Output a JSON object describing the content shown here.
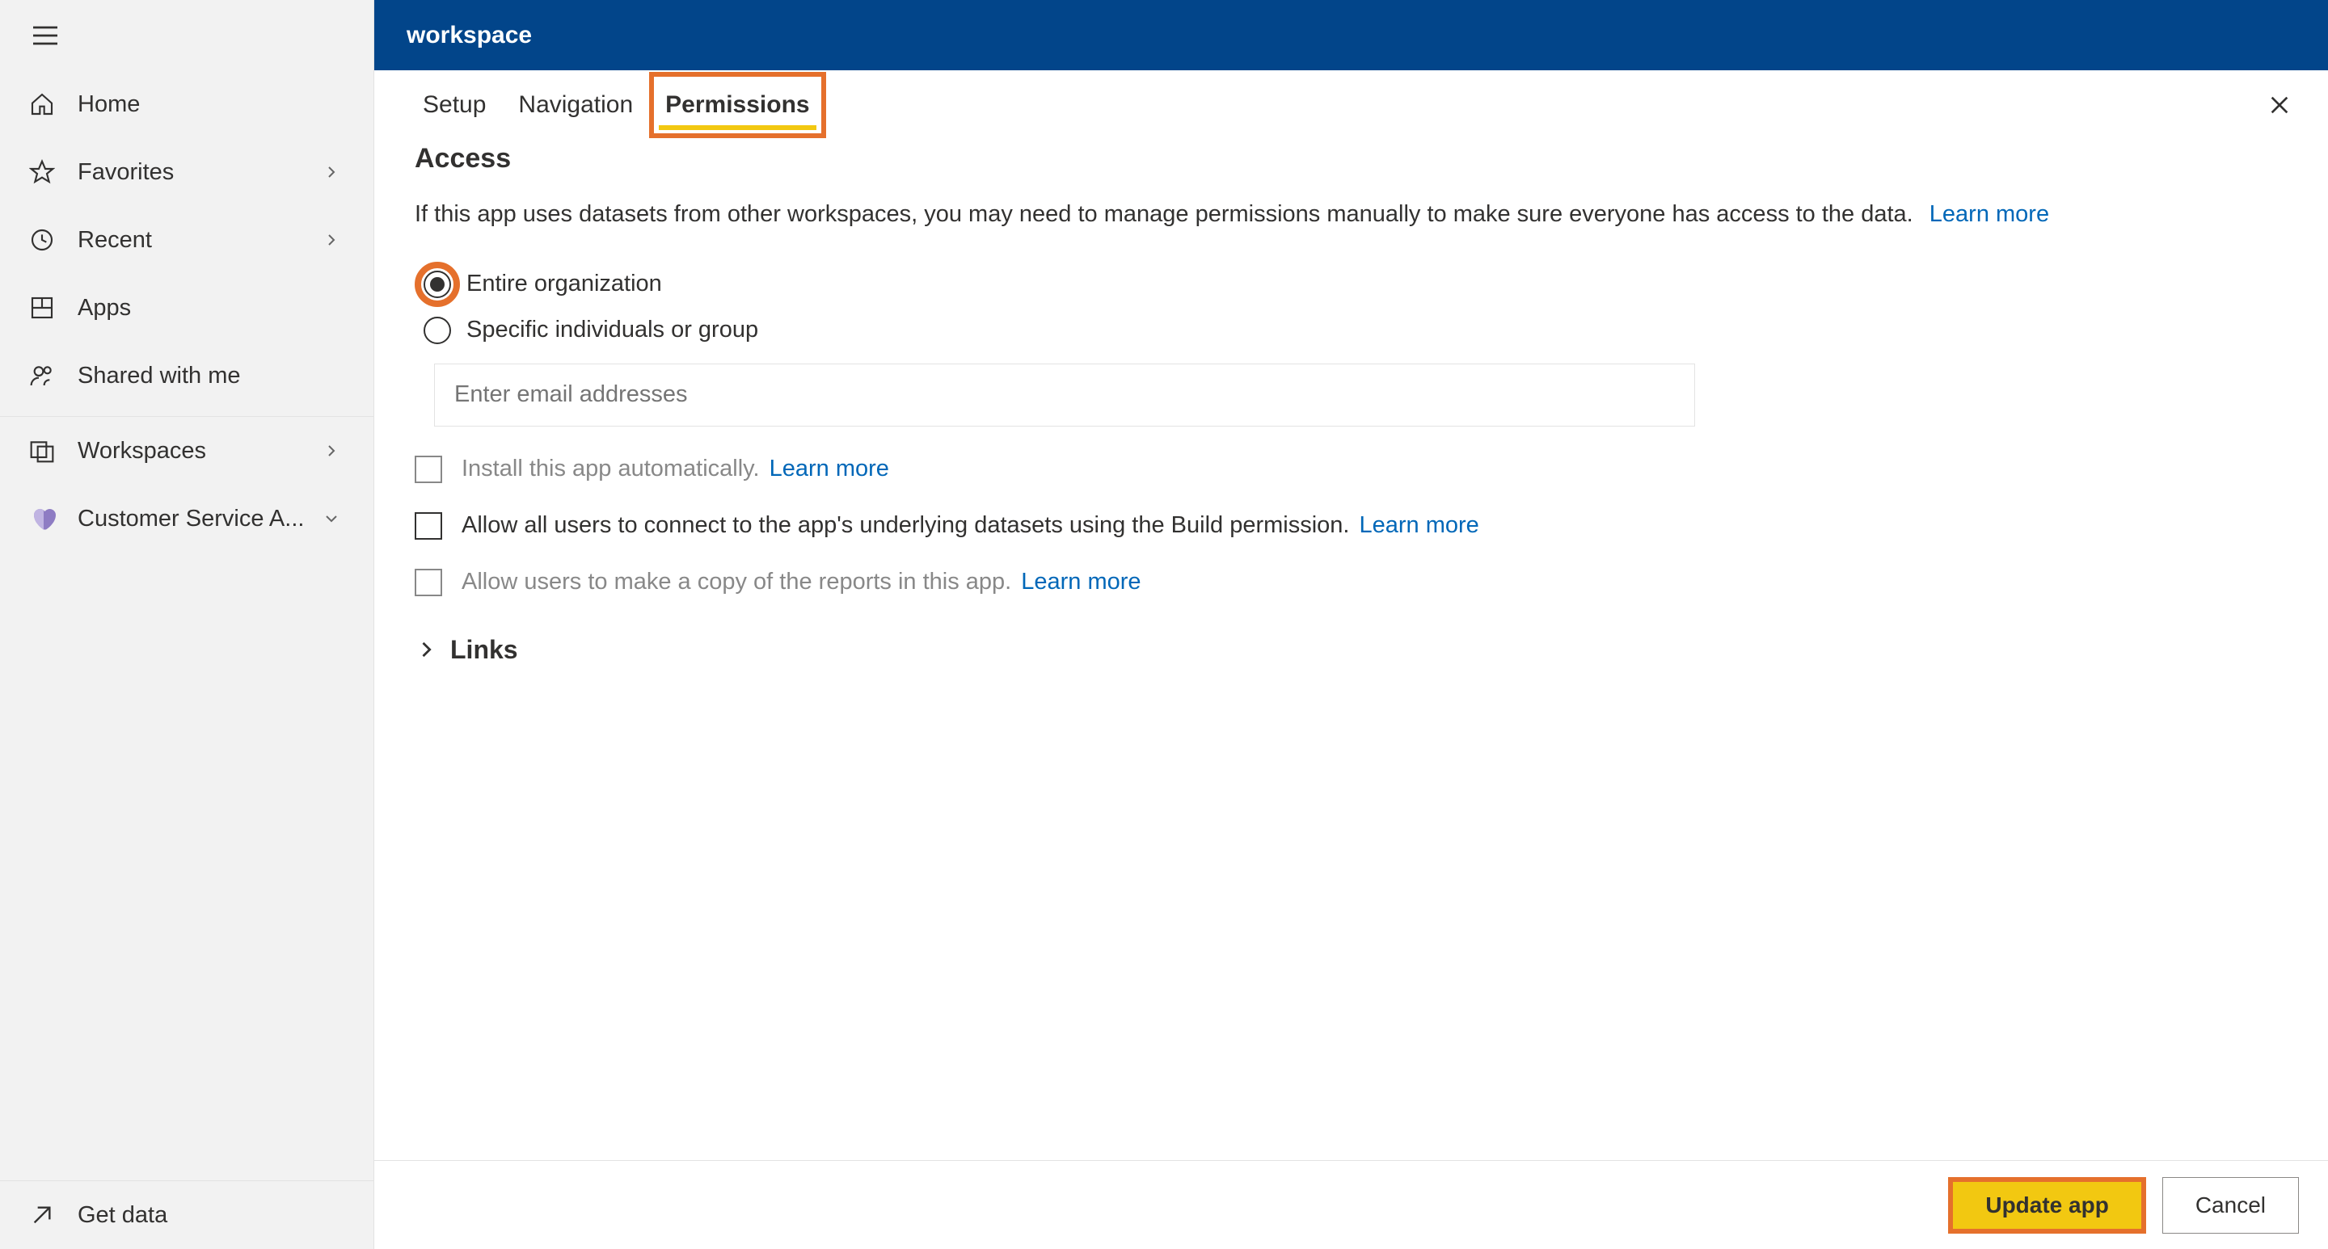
{
  "sidebar": {
    "items": [
      {
        "label": "Home"
      },
      {
        "label": "Favorites"
      },
      {
        "label": "Recent"
      },
      {
        "label": "Apps"
      },
      {
        "label": "Shared with me"
      }
    ],
    "workspaces_label": "Workspaces",
    "current_workspace": "Customer Service A...",
    "get_data_label": "Get data"
  },
  "header": {
    "title": "workspace"
  },
  "tabs": {
    "setup": "Setup",
    "navigation": "Navigation",
    "permissions": "Permissions"
  },
  "access": {
    "title": "Access",
    "desc": "If this app uses datasets from other workspaces, you may need to manage permissions manually to make sure everyone has access to the data.",
    "learn_more": "Learn more",
    "radio_entire": "Entire organization",
    "radio_specific": "Specific individuals or group",
    "email_placeholder": "Enter email addresses",
    "check_install": "Install this app automatically.",
    "check_build": "Allow all users to connect to the app's underlying datasets using the Build permission.",
    "check_copy": "Allow users to make a copy of the reports in this app.",
    "links_label": "Links"
  },
  "footer": {
    "update": "Update app",
    "cancel": "Cancel"
  }
}
